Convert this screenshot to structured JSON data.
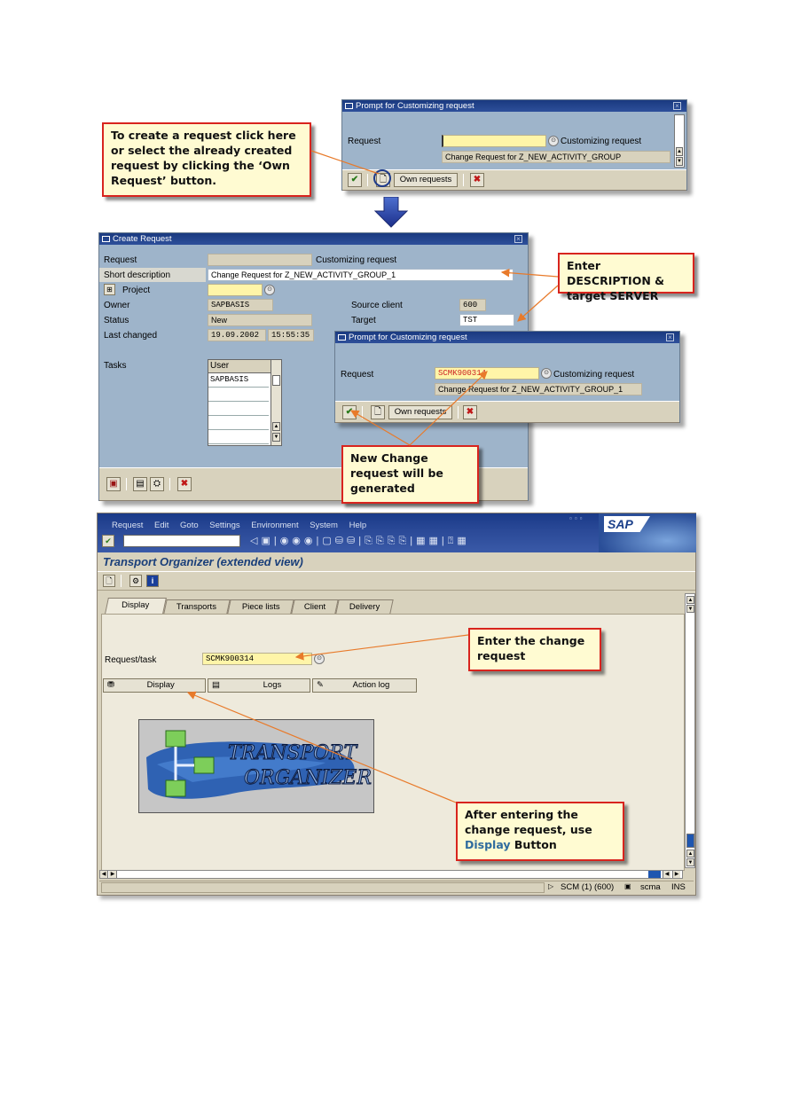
{
  "prompt1": {
    "title": "Prompt for Customizing request",
    "request_label": "Request",
    "request_value": "",
    "customizing_label": "Customizing request",
    "description": "Change Request for Z_NEW_ACTIVITY_GROUP",
    "own_requests_label": "Own requests"
  },
  "callout_create": {
    "text": "To create a request click here or select the already created request by clicking the ‘Own Request’ button."
  },
  "create_request": {
    "title": "Create Request",
    "request_label": "Request",
    "request_value": "",
    "customizing_label": "Customizing request",
    "short_desc_label": "Short description",
    "short_desc_value": "Change Request for Z_NEW_ACTIVITY_GROUP_1",
    "project_label": "Project",
    "owner_label": "Owner",
    "owner_value": "SAPBASIS",
    "source_client_label": "Source client",
    "source_client_value": "600",
    "status_label": "Status",
    "status_value": "New",
    "target_label": "Target",
    "target_value": "TST",
    "last_changed_label": "Last changed",
    "last_changed_date": "19.09.2002",
    "last_changed_time": "15:55:35",
    "tasks_label": "Tasks",
    "tasks_header": "User",
    "tasks_rows": [
      "SAPBASIS",
      "",
      "",
      "",
      "",
      ""
    ]
  },
  "callout_desc": {
    "text": "Enter DESCRIPTION & target SERVER"
  },
  "prompt2": {
    "title": "Prompt for Customizing request",
    "request_label": "Request",
    "request_value": "SCMK900314",
    "customizing_label": "Customizing request",
    "description": "Change Request for Z_NEW_ACTIVITY_GROUP_1",
    "own_requests_label": "Own requests"
  },
  "callout_new": {
    "text": "New Change request will be generated"
  },
  "sap": {
    "menu": [
      "Request",
      "Edit",
      "Goto",
      "Settings",
      "Environment",
      "System",
      "Help"
    ],
    "logo": "SAP",
    "title": "Transport Organizer (extended view)",
    "tabs": [
      "Display",
      "Transports",
      "Piece lists",
      "Client",
      "Delivery"
    ],
    "request_task_label": "Request/task",
    "request_task_value": "SCMK900314",
    "display_label": "Display",
    "logs_label": "Logs",
    "action_log_label": "Action log",
    "logo_text_1": "TRANSPORT",
    "logo_text_2": "ORGANIZER",
    "status_system": "SCM (1) (600)",
    "status_host": "scma",
    "status_mode": "INS"
  },
  "callout_enter": {
    "text": "Enter the change request"
  },
  "callout_display": {
    "text_before": "After entering the change request, use ",
    "highlight": "Display",
    "text_after": " Button"
  },
  "colors": {
    "panel": "#9eb4ca",
    "titlebar": "#1f4088",
    "field_yellow": "#fff5a8",
    "callout_border": "#d8241e",
    "callout_bg": "#fffbd2",
    "arrow": "#e87a2a",
    "sap_title": "#1a3f7a",
    "sap_bg": "#d8d2bd"
  }
}
